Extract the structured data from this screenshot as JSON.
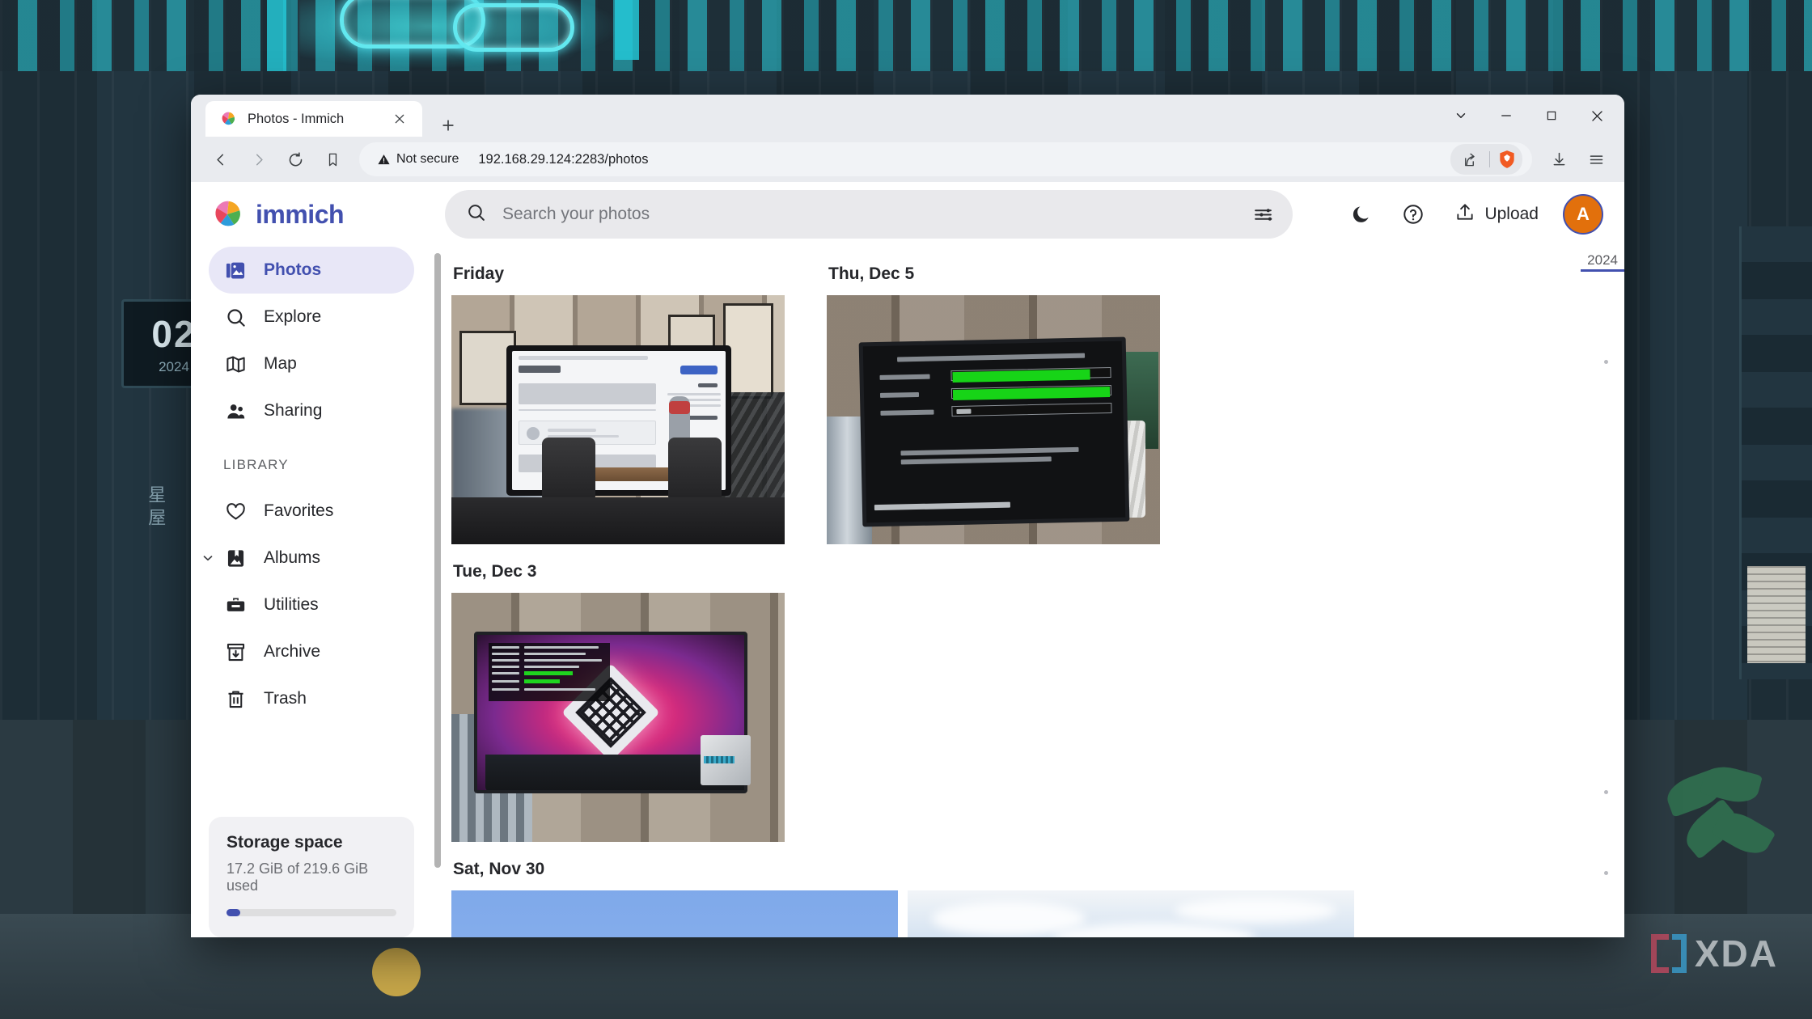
{
  "window": {
    "tab": {
      "title": "Photos - Immich",
      "favicon_icon": "immich-logo-icon",
      "close_icon": "close-icon"
    },
    "newtab_label": "+",
    "controls": {
      "tab_search_icon": "chevron-down-icon",
      "minimize_icon": "minimize-icon",
      "maximize_icon": "maximize-icon",
      "close_icon": "close-icon"
    },
    "toolbar": {
      "back_icon": "back-arrow-icon",
      "forward_icon": "forward-arrow-icon",
      "reload_icon": "reload-icon",
      "bookmark_icon": "bookmark-icon",
      "security_label": "Not secure",
      "security_icon": "warning-triangle-icon",
      "url": "192.168.29.124:2283/photos",
      "share_icon": "share-icon",
      "brave_shield_icon": "brave-lion-shield-icon",
      "download_icon": "download-icon",
      "menu_icon": "hamburger-menu-icon"
    }
  },
  "app": {
    "brand": {
      "name": "immich",
      "logo_icon": "immich-pinwheel-logo-icon",
      "color": "#4250af"
    },
    "search": {
      "placeholder": "Search your photos",
      "search_icon": "search-icon",
      "filter_icon": "filter-sliders-icon"
    },
    "actions": {
      "theme_icon": "moon-icon",
      "help_icon": "question-circle-icon",
      "upload_label": "Upload",
      "upload_icon": "upload-arrow-icon",
      "avatar_initial": "A",
      "avatar_color": "#e2700c"
    },
    "sidebar": {
      "primary": [
        {
          "label": "Photos",
          "icon": "photos-icon",
          "active": true
        },
        {
          "label": "Explore",
          "icon": "search-icon",
          "active": false
        },
        {
          "label": "Map",
          "icon": "map-icon",
          "active": false
        },
        {
          "label": "Sharing",
          "icon": "people-icon",
          "active": false
        }
      ],
      "section_label": "LIBRARY",
      "library": [
        {
          "label": "Favorites",
          "icon": "heart-icon",
          "expandable": false
        },
        {
          "label": "Albums",
          "icon": "album-icon",
          "expandable": true
        },
        {
          "label": "Utilities",
          "icon": "toolbox-icon",
          "expandable": false
        },
        {
          "label": "Archive",
          "icon": "archive-box-icon",
          "expandable": false
        },
        {
          "label": "Trash",
          "icon": "trash-icon",
          "expandable": false
        }
      ],
      "storage": {
        "title": "Storage space",
        "detail": "17.2 GiB of 219.6 GiB used",
        "used_percent": 8
      }
    },
    "timeline": {
      "groups": [
        {
          "label": "Friday",
          "count": 1
        },
        {
          "label": "Thu, Dec 5",
          "count": 1
        },
        {
          "label": "Tue, Dec 3",
          "count": 1
        },
        {
          "label": "Sat, Nov 30",
          "count": 2
        }
      ],
      "scrubber": {
        "year": "2024"
      }
    }
  },
  "desktop": {
    "calendar": {
      "day": "02",
      "year": "2024"
    },
    "watermark": "XDA"
  }
}
